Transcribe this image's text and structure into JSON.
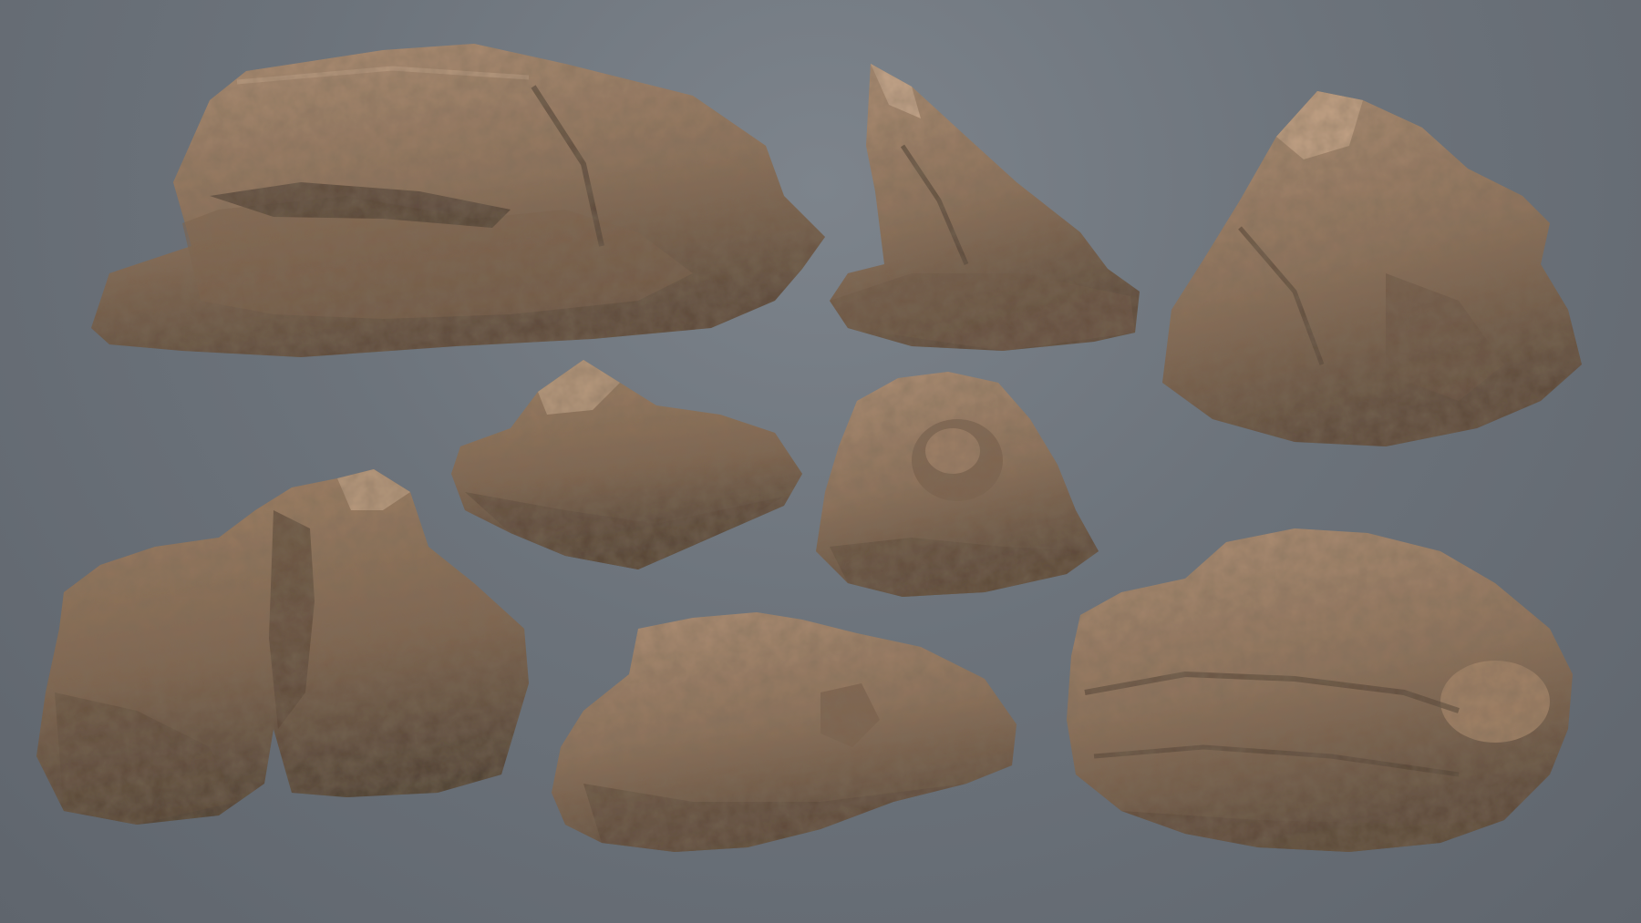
{
  "scene": {
    "background_color": "#6c737b",
    "rock_base_color": "#8f735c",
    "rock_light_color": "#b39378",
    "rock_shadow_color": "#4e3f33",
    "rock_count": 8,
    "rocks": [
      {
        "name": "large-flat-boulder"
      },
      {
        "name": "leaning-spire-rock"
      },
      {
        "name": "blocky-cliff-rock"
      },
      {
        "name": "low-slab-cluster"
      },
      {
        "name": "mound-rock"
      },
      {
        "name": "twin-pillar-rock"
      },
      {
        "name": "flat-rubble-pile"
      },
      {
        "name": "layered-outcrop"
      }
    ]
  }
}
